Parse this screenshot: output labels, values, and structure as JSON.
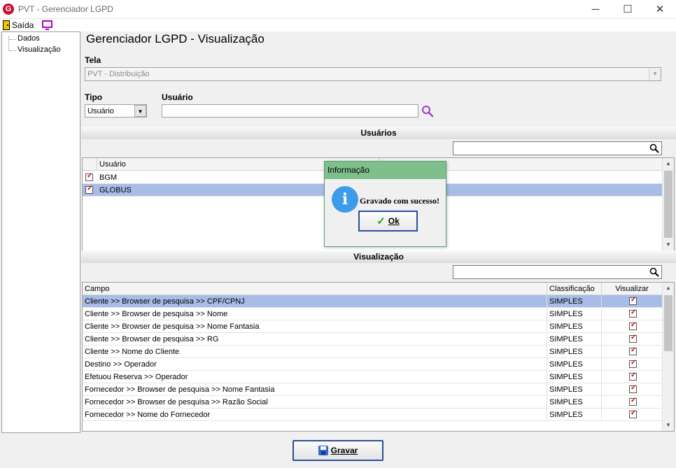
{
  "window": {
    "title": "PVT - Gerenciador LGPD",
    "logo_letter": "G",
    "min_icon": "─",
    "max_icon": "☐",
    "close_icon": "✕"
  },
  "menu": {
    "exit_label": "Saída"
  },
  "tree": {
    "items": [
      {
        "label": "Dados"
      },
      {
        "label": "Visualização"
      }
    ]
  },
  "page": {
    "title": "Gerenciador LGPD - Visualização",
    "tela_label": "Tela",
    "tela_value": "PVT - Distribuição",
    "tipo_label": "Tipo",
    "tipo_value": "Usuário",
    "usuario_label": "Usuário",
    "usuario_value": ""
  },
  "usuarios_section": {
    "header": "Usuários",
    "search_value": "",
    "column_header": "Usuário",
    "rows": [
      {
        "checked": true,
        "name": "BGM",
        "selected": false
      },
      {
        "checked": true,
        "name": "GLOBUS",
        "selected": true
      }
    ]
  },
  "visualizacao_section": {
    "header": "Visualização",
    "search_value": "",
    "columns": [
      "Campo",
      "Classificação",
      "Visualizar"
    ],
    "rows": [
      {
        "campo": "Cliente >> Browser de pesquisa >> CPF/CPNJ",
        "classificacao": "SIMPLES",
        "visualizar": true,
        "selected": true
      },
      {
        "campo": "Cliente >> Browser de pesquisa >> Nome",
        "classificacao": "SIMPLES",
        "visualizar": true,
        "selected": false
      },
      {
        "campo": "Cliente >> Browser de pesquisa >> Nome Fantasia",
        "classificacao": "SIMPLES",
        "visualizar": true,
        "selected": false
      },
      {
        "campo": "Cliente >> Browser de pesquisa >> RG",
        "classificacao": "SIMPLES",
        "visualizar": true,
        "selected": false
      },
      {
        "campo": "Cliente >> Nome do Cliente",
        "classificacao": "SIMPLES",
        "visualizar": true,
        "selected": false
      },
      {
        "campo": "Destino >> Operador",
        "classificacao": "SIMPLES",
        "visualizar": true,
        "selected": false
      },
      {
        "campo": "Efetuou Reserva >> Operador",
        "classificacao": "SIMPLES",
        "visualizar": true,
        "selected": false
      },
      {
        "campo": "Fornecedor >> Browser de pesquisa >> Nome Fantasia",
        "classificacao": "SIMPLES",
        "visualizar": true,
        "selected": false
      },
      {
        "campo": "Fornecedor >> Browser de pesquisa >> Razão Social",
        "classificacao": "SIMPLES",
        "visualizar": true,
        "selected": false
      },
      {
        "campo": "Fornecedor >> Nome do Fornecedor",
        "classificacao": "SIMPLES",
        "visualizar": true,
        "selected": false
      }
    ]
  },
  "footer": {
    "save_label": "Gravar"
  },
  "dialog": {
    "title": "Informação",
    "icon_letter": "i",
    "message": "Gravado com sucesso!",
    "ok_label": "Ok"
  },
  "colors": {
    "selection": "#a7bce6",
    "dialog_title_bg": "#7fbf8c",
    "check_red": "#d10000",
    "button_border": "#2a4f9c"
  }
}
